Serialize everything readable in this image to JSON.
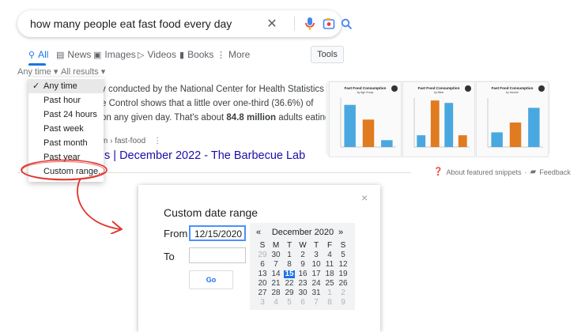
{
  "search": {
    "query": "how many people eat fast food every day",
    "icons": {
      "clear": "close-icon",
      "voice": "mic-icon",
      "lens": "camera-icon",
      "search": "search-icon"
    }
  },
  "tabs": [
    {
      "label": "All",
      "icon": "search-icon"
    },
    {
      "label": "News",
      "icon": "newspaper-icon"
    },
    {
      "label": "Images",
      "icon": "image-icon"
    },
    {
      "label": "Videos",
      "icon": "play-icon"
    },
    {
      "label": "Books",
      "icon": "book-icon"
    },
    {
      "label": "More",
      "icon": "more-vert-icon"
    }
  ],
  "tools_label": "Tools",
  "filters": {
    "time": "Any time ▾",
    "results": "All results ▾"
  },
  "dropdown": {
    "items": [
      "Any time",
      "Past hour",
      "Past 24 hours",
      "Past week",
      "Past month",
      "Past year",
      "Custom range..."
    ],
    "selected": 0
  },
  "snippet": {
    "line1": "y conducted by the National Center for Health Statistics",
    "line2": "e Control shows that a little over one-third (36.6%) of",
    "line3_pre": " on any given day. That's about ",
    "line3_bold": "84.8 million",
    "line3_post": " adults eating",
    "breadcrumb": "m › fast-food",
    "link": "s | December 2022 - The Barbecue Lab"
  },
  "images": [
    {
      "title": "Fast Food Consumption",
      "sub": "by Age Group",
      "bars": [
        {
          "value": 0.86,
          "color": "#4aa8e0"
        },
        {
          "value": 0.56,
          "color": "#e07b1f"
        },
        {
          "value": 0.14,
          "color": "#4aa8e0"
        }
      ]
    },
    {
      "title": "Fast Food Consumption",
      "sub": "by Meal",
      "bars": [
        {
          "value": 0.24,
          "color": "#4aa8e0"
        },
        {
          "value": 0.95,
          "color": "#e07b1f"
        },
        {
          "value": 0.9,
          "color": "#4aa8e0"
        },
        {
          "value": 0.24,
          "color": "#e07b1f"
        }
      ]
    },
    {
      "title": "Fast Food Consumption",
      "sub": "by Income",
      "bars": [
        {
          "value": 0.3,
          "color": "#4aa8e0"
        },
        {
          "value": 0.5,
          "color": "#e07b1f"
        },
        {
          "value": 0.8,
          "color": "#4aa8e0"
        }
      ]
    }
  ],
  "about": {
    "text": "About featured snippets",
    "sep": "·",
    "feedback": "Feedback"
  },
  "dialog": {
    "title": "Custom date range",
    "from_label": "From",
    "from_value": "12/15/2020",
    "to_label": "To",
    "to_value": "",
    "go_label": "Go",
    "close": "×",
    "calendar": {
      "prev": "«",
      "month": "December 2020",
      "next": "»",
      "weekdays": [
        "S",
        "M",
        "T",
        "W",
        "T",
        "F",
        "S"
      ],
      "weeks": [
        [
          {
            "d": "29",
            "dim": true
          },
          {
            "d": "30",
            "dim": false
          },
          {
            "d": "1"
          },
          {
            "d": "2"
          },
          {
            "d": "3"
          },
          {
            "d": "4"
          },
          {
            "d": "5"
          }
        ],
        [
          {
            "d": "6"
          },
          {
            "d": "7"
          },
          {
            "d": "8"
          },
          {
            "d": "9"
          },
          {
            "d": "10"
          },
          {
            "d": "11"
          },
          {
            "d": "12"
          }
        ],
        [
          {
            "d": "13"
          },
          {
            "d": "14"
          },
          {
            "d": "15",
            "today": true
          },
          {
            "d": "16"
          },
          {
            "d": "17"
          },
          {
            "d": "18"
          },
          {
            "d": "19"
          }
        ],
        [
          {
            "d": "20"
          },
          {
            "d": "21"
          },
          {
            "d": "22"
          },
          {
            "d": "23"
          },
          {
            "d": "24"
          },
          {
            "d": "25"
          },
          {
            "d": "26"
          }
        ],
        [
          {
            "d": "27"
          },
          {
            "d": "28"
          },
          {
            "d": "29"
          },
          {
            "d": "30"
          },
          {
            "d": "31"
          },
          {
            "d": "1",
            "dim": true
          },
          {
            "d": "2",
            "dim": true
          }
        ],
        [
          {
            "d": "3",
            "dim": true
          },
          {
            "d": "4",
            "dim": true
          },
          {
            "d": "5",
            "dim": true
          },
          {
            "d": "6",
            "dim": true
          },
          {
            "d": "7",
            "dim": true
          },
          {
            "d": "8",
            "dim": true
          },
          {
            "d": "9",
            "dim": true
          }
        ]
      ]
    }
  },
  "colors": {
    "accent": "#1a73e8",
    "link": "#1a0dab",
    "annotation": "#e0322b"
  }
}
